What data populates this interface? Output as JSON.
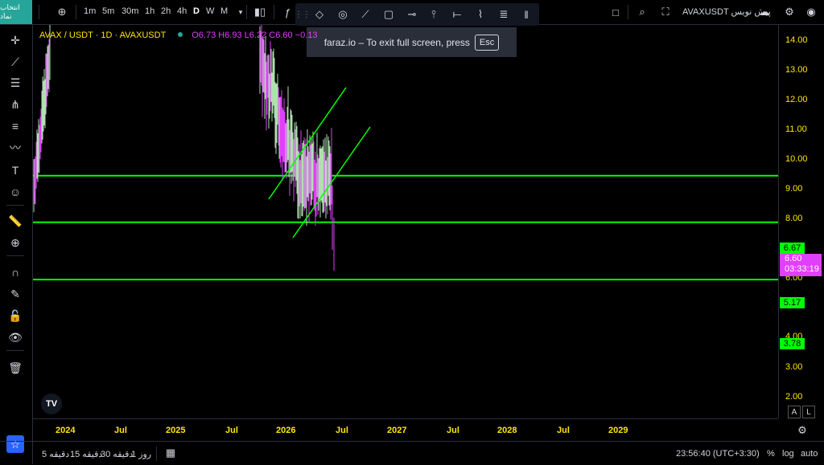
{
  "topbar": {
    "symbol_button": "انتخاب نماد",
    "timeframes": [
      "1m",
      "5m",
      "30m",
      "1h",
      "2h",
      "4h",
      "D",
      "W",
      "M"
    ],
    "active_timeframe": "D",
    "symbol_title": "AVAXUSDT پیش نویس"
  },
  "toast": {
    "message": "faraz.io – To exit full screen, press",
    "key": "Esc"
  },
  "legend": {
    "title": "AVAX / USDT · 1D · AVAXUSDT",
    "open": "O6.73",
    "high": "H6.93",
    "low": "L6.22",
    "close": "C6.60",
    "change": "−0.13"
  },
  "price_axis": {
    "ticks": [
      "14.00",
      "13.00",
      "12.00",
      "11.00",
      "10.00",
      "9.00",
      "8.00",
      "6.00",
      "4.00",
      "3.00",
      "2.00"
    ],
    "levels": [
      "6.67",
      "5.17",
      "3.78"
    ],
    "current_price": "6.60",
    "countdown": "03:33:19"
  },
  "time_axis": {
    "ticks": [
      "2024",
      "Jul",
      "2025",
      "Jul",
      "2026",
      "Jul",
      "2027",
      "Jul",
      "2028",
      "Jul",
      "2029"
    ]
  },
  "bottombar": {
    "ranges": [
      "5 دقیقه",
      "15 دقیقه",
      "30 دقیقه",
      "1 روز"
    ],
    "clock": "23:56:40 (UTC+3:30)",
    "percent": "%",
    "log": "log",
    "auto": "auto"
  },
  "scale_buttons": {
    "a": "A",
    "l": "L"
  },
  "logo_text": "TV",
  "chart_data": {
    "type": "line",
    "title": "AVAX / USDT · 1D · AVAXUSDT",
    "x": [
      "2024",
      "Jul",
      "2025",
      "Jul",
      "2026",
      "Jul",
      "2027",
      "Jul",
      "2028",
      "Jul",
      "2029"
    ],
    "ylim": [
      1.6,
      14.6
    ],
    "log_scale": true,
    "horizontal_levels": [
      6.67,
      5.17,
      3.78
    ],
    "current_price": 6.6,
    "colors": {
      "level": "#00ff00",
      "candle": "#e040fb",
      "channel": "#00ff00",
      "axis_text": "#ffe600"
    }
  }
}
